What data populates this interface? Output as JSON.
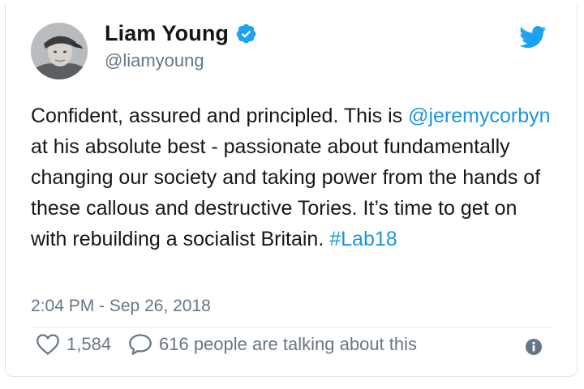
{
  "tweet": {
    "author": {
      "display_name": "Liam Young",
      "handle": "@liamyoung",
      "verified": true
    },
    "text_segments": [
      {
        "text": "Confident, assured and principled. This is ",
        "type": "text"
      },
      {
        "text": "@jeremycorbyn",
        "type": "mention"
      },
      {
        "text": " at his absolute best - passionate about fundamentally changing our society and taking power from the hands of these callous and destructive Tories. It’s time to get on with rebuilding a socialist Britain. ",
        "type": "text"
      },
      {
        "text": "#Lab18",
        "type": "hashtag"
      }
    ],
    "timestamp": "2:04 PM - Sep 26, 2018",
    "likes_count": "1,584",
    "talking_text": "616 people are talking about this"
  },
  "icons": {
    "brand": "twitter-bird-icon",
    "verified": "verified-badge-icon",
    "like": "heart-icon",
    "reply": "speech-bubble-icon",
    "info": "info-icon"
  },
  "colors": {
    "link": "#1b95e0",
    "secondary_text": "#657786",
    "brand_blue": "#1da1f2",
    "icon_gray": "#657786"
  }
}
